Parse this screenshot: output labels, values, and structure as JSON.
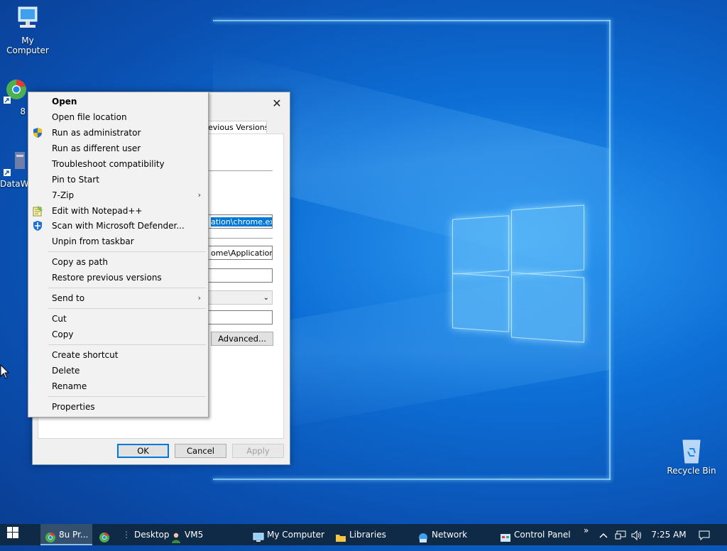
{
  "desktop": {
    "icons": [
      {
        "label": "My Computer",
        "icon": "my-computer-icon"
      },
      {
        "label": "8",
        "icon": "chrome-shortcut-icon"
      },
      {
        "label": "DataW",
        "icon": "dataw-shortcut-icon"
      },
      {
        "label": "Recycle Bin",
        "icon": "recycle-bin-icon"
      }
    ]
  },
  "dialog": {
    "close_glyph": "✕",
    "tab_label": "evious Versions",
    "target_value": "ation\\chrome.exe\"",
    "start_in_value": "ome\\Application\"",
    "shortcut_key_value": "",
    "run_value": "",
    "comment_value": "",
    "advanced_label": "Advanced...",
    "ok_label": "OK",
    "cancel_label": "Cancel",
    "apply_label": "Apply"
  },
  "context_menu": {
    "items": [
      {
        "label": "Open"
      },
      {
        "label": "Open file location"
      },
      {
        "label": "Run as administrator"
      },
      {
        "label": "Run as different user"
      },
      {
        "label": "Troubleshoot compatibility"
      },
      {
        "label": "Pin to Start"
      },
      {
        "label": "7-Zip"
      },
      {
        "label": "Edit with Notepad++"
      },
      {
        "label": "Scan with Microsoft Defender..."
      },
      {
        "label": "Unpin from taskbar"
      },
      {
        "label": "Copy as path"
      },
      {
        "label": "Restore previous versions"
      },
      {
        "label": "Send to"
      },
      {
        "label": "Cut"
      },
      {
        "label": "Copy"
      },
      {
        "label": "Create shortcut"
      },
      {
        "label": "Delete"
      },
      {
        "label": "Rename"
      },
      {
        "label": "Properties"
      }
    ],
    "submenu_arrow": "›"
  },
  "taskbar": {
    "chrome_window_label": "8u Pr...",
    "desktop_label": "Desktop",
    "vm_label": "VM5",
    "my_computer_label": "My Computer",
    "libraries_label": "Libraries",
    "network_label": "Network",
    "control_panel_label": "Control Panel",
    "overflow_glyph": "»",
    "tray_up_glyph": "^",
    "volume_glyph": "🔊",
    "time": "7:25 AM"
  },
  "colors": {
    "accent": "#0078d7",
    "taskbar": "#0f2a46"
  }
}
